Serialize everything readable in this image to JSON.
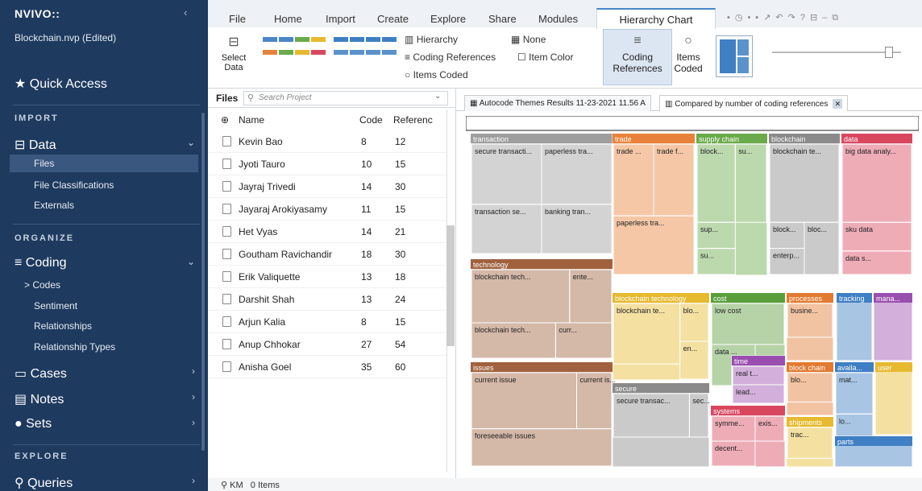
{
  "app": {
    "brand": "NVIVO",
    "brand_mark": "::",
    "project": "Blockchain.nvp (Edited)"
  },
  "sidebar": {
    "quick_access": "Quick Access",
    "sections": [
      {
        "label": "IMPORT"
      },
      {
        "label": "ORGANIZE"
      },
      {
        "label": "EXPLORE"
      }
    ],
    "groups": {
      "data": {
        "label": "Data",
        "items": [
          "Files",
          "File Classifications",
          "Externals"
        ]
      },
      "coding": {
        "label": "Coding",
        "items": [
          "> Codes",
          "Sentiment",
          "Relationships",
          "Relationship Types"
        ]
      },
      "cases": {
        "label": "Cases"
      },
      "notes": {
        "label": "Notes"
      },
      "sets": {
        "label": "Sets"
      },
      "queries": {
        "label": "Queries"
      }
    }
  },
  "menu_tabs": [
    "File",
    "Home",
    "Import",
    "Create",
    "Explore",
    "Share",
    "Modules"
  ],
  "active_tab": "Hierarchy Chart",
  "ribbon": {
    "select_data": "Select\nData",
    "opt_hierarchy": "Hierarchy",
    "opt_none": "None",
    "opt_coding_refs": "Coding References",
    "opt_item_color": "Item Color",
    "opt_items_coded": "Items Coded",
    "btn_coding_refs": "Coding\nReferences",
    "btn_items_coded": "Items\nCoded"
  },
  "files": {
    "title": "Files",
    "search_placeholder": "Search Project",
    "columns": [
      "Name",
      "Code",
      "Referenc"
    ],
    "rows": [
      {
        "name": "Kevin Bao",
        "code": "8",
        "refs": "12"
      },
      {
        "name": "Jyoti Tauro",
        "code": "10",
        "refs": "15"
      },
      {
        "name": "Jayraj Trivedi",
        "code": "14",
        "refs": "30"
      },
      {
        "name": "Jayaraj Arokiyasamy",
        "code": "11",
        "refs": "15"
      },
      {
        "name": "Het Vyas",
        "code": "14",
        "refs": "21"
      },
      {
        "name": "Goutham Ravichandir",
        "code": "18",
        "refs": "30"
      },
      {
        "name": "Erik Valiquette",
        "code": "13",
        "refs": "18"
      },
      {
        "name": "Darshit Shah",
        "code": "13",
        "refs": "24"
      },
      {
        "name": "Arjun Kalia",
        "code": "8",
        "refs": "15"
      },
      {
        "name": "Anup Chhokar",
        "code": "27",
        "refs": "54"
      },
      {
        "name": "Anisha Goel",
        "code": "35",
        "refs": "60"
      }
    ]
  },
  "doc_tabs": [
    {
      "label": "Autocode Themes Results 11-23-2021 11.56 A"
    },
    {
      "label": "Compared by number of coding references"
    }
  ],
  "status": {
    "user": "KM",
    "items": "0 Items"
  },
  "chart_data": {
    "type": "treemap",
    "nodes": [
      {
        "name": "transaction",
        "color": "#9e9e9e",
        "children": [
          "secure transacti...",
          "paperless tra...",
          "transaction se...",
          "banking tran..."
        ]
      },
      {
        "name": "trade",
        "color": "#e8823a",
        "children": [
          "trade ...",
          "trade f...",
          "paperless tra..."
        ]
      },
      {
        "name": "supply chain",
        "color": "#6aaa4a",
        "children": [
          "block...",
          "su...",
          "sup...",
          "su..."
        ]
      },
      {
        "name": "blockchain",
        "color": "#8a8a8a",
        "children": [
          "blockchain te...",
          "block...",
          "bloc...",
          "enterp..."
        ]
      },
      {
        "name": "data",
        "color": "#d9475f",
        "children": [
          "big data analy...",
          "sku data",
          "data s..."
        ]
      },
      {
        "name": "technology",
        "color": "#a0613e",
        "children": [
          "blockchain tech...",
          "ente...",
          "blockchain tech...",
          "curr..."
        ]
      },
      {
        "name": "blockchain technology",
        "color": "#e6b92e",
        "children": [
          "blockchain te...",
          "blo...",
          "en..."
        ]
      },
      {
        "name": "cost",
        "color": "#5a9e3c",
        "children": [
          "low cost",
          "data ..."
        ]
      },
      {
        "name": "processes",
        "color": "#e27a30",
        "children": [
          "busine..."
        ]
      },
      {
        "name": "tracking",
        "color": "#3f7fc4",
        "children": []
      },
      {
        "name": "mana...",
        "color": "#9a4fb0",
        "children": []
      },
      {
        "name": "issues",
        "color": "#a0613e",
        "children": [
          "current issue",
          "current is...",
          "foreseeable issues"
        ]
      },
      {
        "name": "secure",
        "color": "#8a8a8a",
        "children": [
          "secure transac...",
          "sec..."
        ]
      },
      {
        "name": "time",
        "color": "#9a4fb0",
        "children": [
          "real t...",
          "lead..."
        ]
      },
      {
        "name": "systems",
        "color": "#d9475f",
        "children": [
          "symme...",
          "exis...",
          "decent..."
        ]
      },
      {
        "name": "block chain",
        "color": "#e27a30",
        "children": [
          "blo..."
        ]
      },
      {
        "name": "availa...",
        "color": "#3f7fc4",
        "children": [
          "mat...",
          "lo..."
        ]
      },
      {
        "name": "user",
        "color": "#e6b92e",
        "children": []
      },
      {
        "name": "shipments",
        "color": "#e6b92e",
        "children": [
          "trac..."
        ]
      },
      {
        "name": "parts",
        "color": "#3f7fc4",
        "children": []
      }
    ]
  }
}
